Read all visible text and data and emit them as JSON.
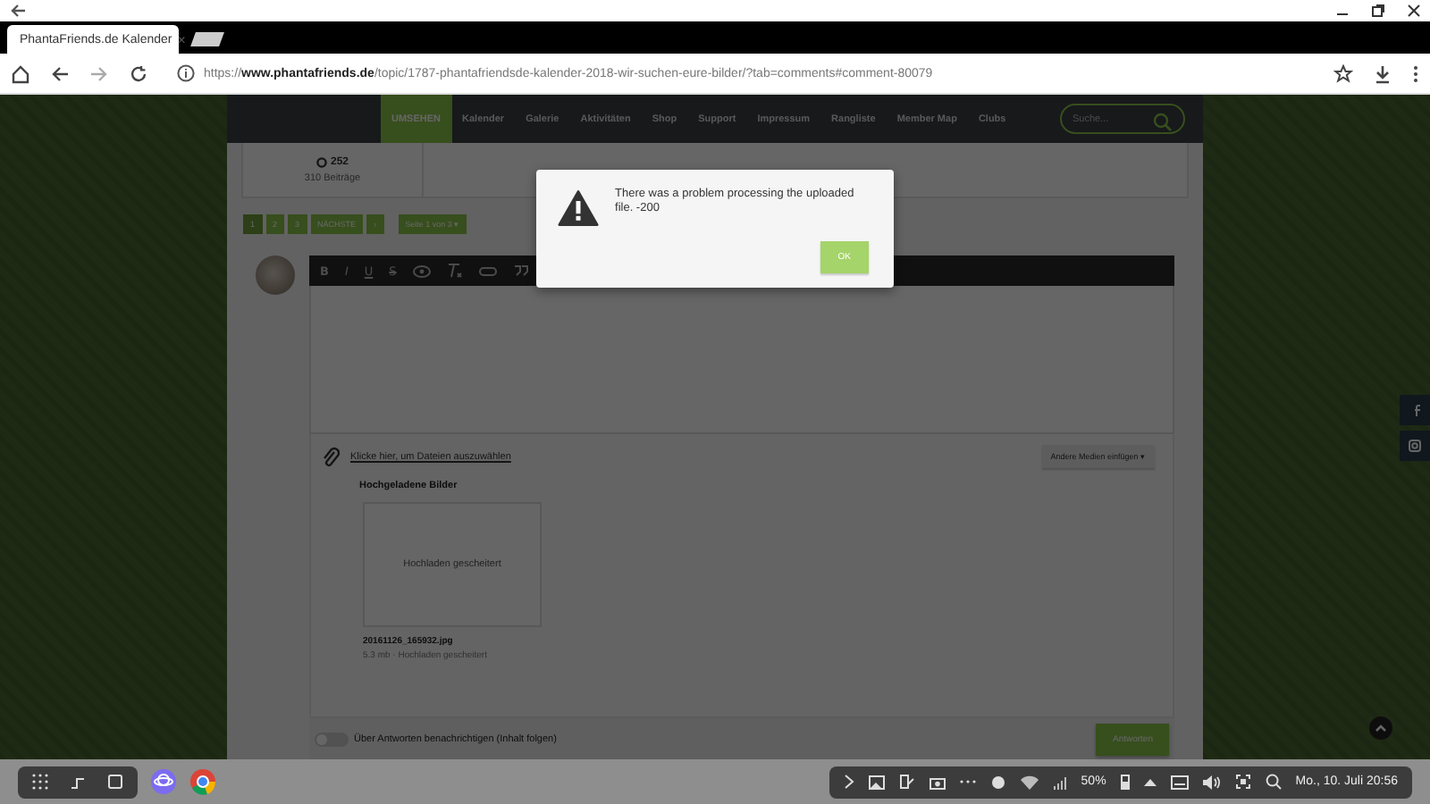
{
  "browser": {
    "tab": {
      "title": "PhantaFriends.de Kalender",
      "close": "×"
    },
    "url": {
      "scheme": "https://",
      "host": "www.phantafriends.de",
      "path": "/topic/1787-phantafriendsde-kalender-2018-wir-suchen-eure-bilder/?tab=comments#comment-80079"
    }
  },
  "nav": {
    "items": [
      {
        "label": "UMSEHEN",
        "selected": true
      },
      {
        "label": "Kalender",
        "selected": false
      },
      {
        "label": "Galerie",
        "selected": false
      },
      {
        "label": "Aktivitäten",
        "selected": false
      },
      {
        "label": "Shop",
        "selected": false
      },
      {
        "label": "Support",
        "selected": false
      },
      {
        "label": "Impressum",
        "selected": false
      },
      {
        "label": "Rangliste",
        "selected": false
      },
      {
        "label": "Member Map",
        "selected": false
      },
      {
        "label": "Clubs",
        "selected": false
      }
    ],
    "search": {
      "placeholder": "Suche..."
    }
  },
  "profile": {
    "reputation": "252",
    "posts": "310 Beiträge"
  },
  "pagination": {
    "pages": [
      {
        "label": "1",
        "selected": true
      },
      {
        "label": "2",
        "selected": false
      },
      {
        "label": "3",
        "selected": false
      }
    ],
    "next": "NÄCHSTE",
    "last": "›",
    "jump": "Seite 1 von 3 ▾"
  },
  "editor": {
    "toolbar": [
      "B",
      "I",
      "U",
      "S"
    ]
  },
  "attachments": {
    "link": "Klicke hier, um Dateien auszuwählen",
    "media_button": "Andere Medien einfügen ▾",
    "heading": "Hochgeladene Bilder",
    "files": [
      {
        "thumb_text": "Hochladen gescheitert",
        "name": "20161126_165932.jpg",
        "meta": "5.3 mb · Hochladen gescheitert"
      }
    ]
  },
  "footer": {
    "follow": {
      "on": false,
      "label": "Über Antworten benachrichtigen (Inhalt folgen)"
    },
    "submit": "Antworten"
  },
  "dialog": {
    "message": "There was a problem processing the uploaded file. -200",
    "ok": "OK"
  },
  "taskbar": {
    "battery": "50%",
    "clock": "Mo., 10. Juli 20:56"
  }
}
